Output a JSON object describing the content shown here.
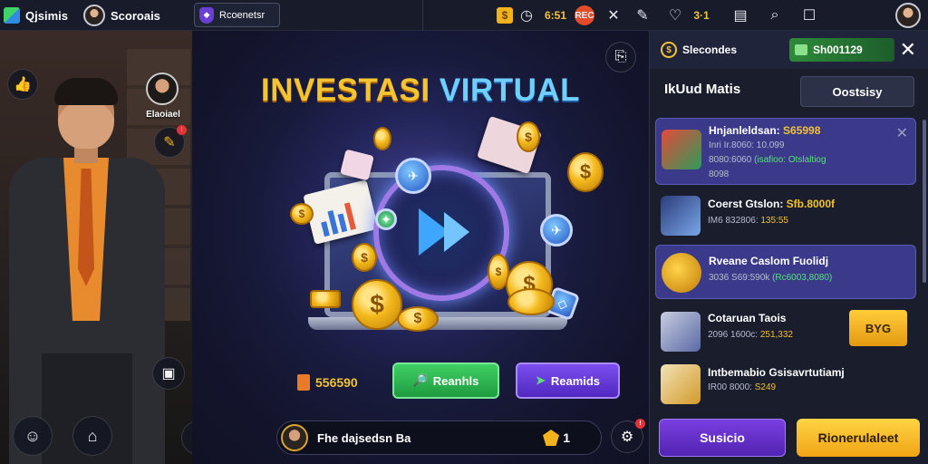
{
  "topbar": {
    "app_name": "Qjsimis",
    "user_name": "Scoroais",
    "search_value": "Rcoenetsr",
    "coin_count": "6:51",
    "record_label": "REC",
    "hearts_count": "3·1",
    "icons": [
      "cube-logo-icon",
      "avatar-icon",
      "shield-icon",
      "coin-icon",
      "clock-icon",
      "record-icon",
      "close-icon",
      "wrench-icon",
      "heart-icon",
      "window-icon",
      "search-icon",
      "maximize-icon",
      "profile-icon"
    ]
  },
  "left": {
    "host_name": "Elaoiael",
    "buttons": [
      "thumbs-up-icon",
      "gift-icon",
      "shop-icon",
      "users-icon",
      "trash-icon",
      "game-icon"
    ]
  },
  "stage": {
    "title_part1": "INVESTASI",
    "title_part2": "VIRTUAL",
    "balance": "556590",
    "btn_green": "Reanhls",
    "btn_purple": "Reamids",
    "chat_text": "Fhe dajsedsn Ba",
    "chat_count": "1"
  },
  "panel": {
    "coin_label": "Slecondes",
    "cash_value": "Sh001129",
    "title": "IkUud Matis",
    "tab": "Oostsisy",
    "items": [
      {
        "name_a": "Hnjanleldsan: ",
        "name_b": "S65998",
        "sub1": "Inri Ir.8060: 10.099",
        "sub2_a": "8080:6060 ",
        "sub2_b": "(isafioo: Otslaltiog",
        "sub3": "8098"
      },
      {
        "name_a": "Coerst Gtslon: ",
        "name_b": "Sfb.8000f",
        "sub1_a": "IM6 832806: ",
        "sub1_b": "135:55"
      },
      {
        "name_a": "Rveane Caslom Fuolidj",
        "sub1_a": "3036 S69:590k ",
        "sub1_b": "(Rc6003,8080)"
      },
      {
        "name_a": "Cotaruan Taois",
        "sub1_a": "2096 1600c: ",
        "sub1_b": "251,332"
      },
      {
        "name_a": "Intbemabio Gsisavrtutiamj",
        "sub1_a": "IR00 8000: ",
        "sub1_b": "S249"
      }
    ],
    "buy_label": "BYG",
    "btn_a": "Susicio",
    "btn_b": "Rionerulaleet"
  }
}
